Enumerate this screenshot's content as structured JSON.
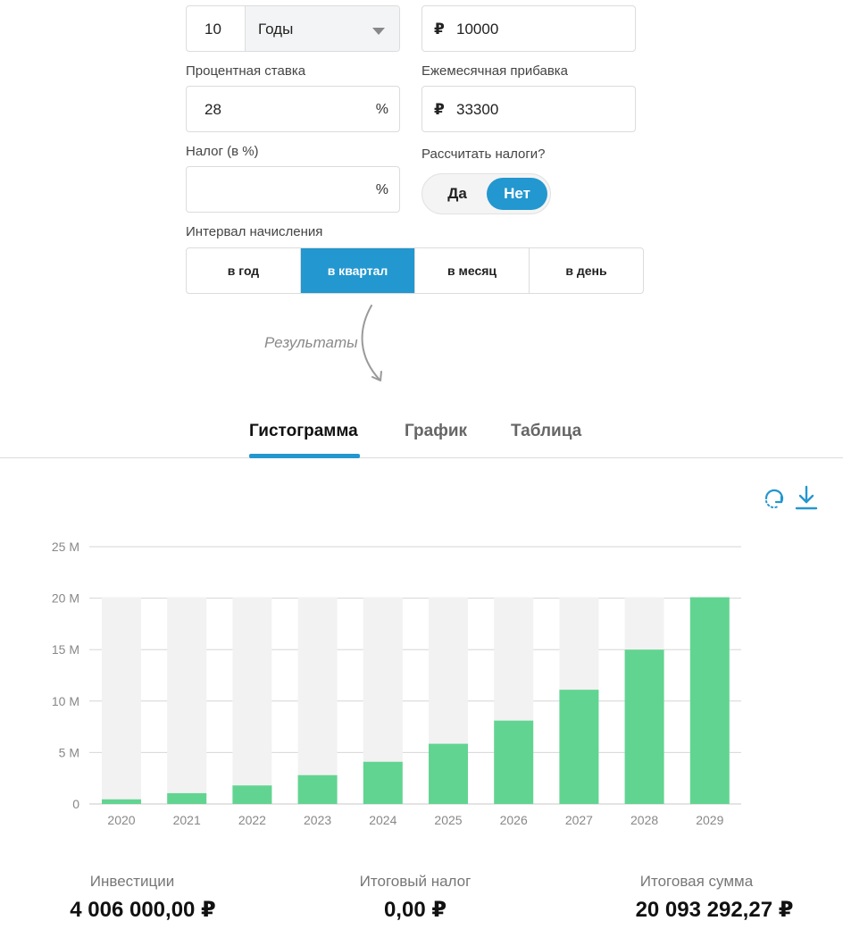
{
  "form": {
    "years_value": "10",
    "years_unit": "Годы",
    "initial_currency": "₽",
    "initial_value": "10000",
    "rate_label": "Процентная ставка",
    "rate_value": "28",
    "rate_suffix": "%",
    "monthly_label": "Ежемесячная прибавка",
    "monthly_currency": "₽",
    "monthly_value": "33300",
    "tax_label": "Налог (в %)",
    "tax_value": "",
    "tax_suffix": "%",
    "calc_tax_label": "Рассчитать налоги?",
    "toggle_yes": "Да",
    "toggle_no": "Нет",
    "interval_label": "Интервал начисления",
    "intervals": [
      "в год",
      "в квартал",
      "в месяц",
      "в день"
    ],
    "selected_interval": "в квартал"
  },
  "results_label": "Результаты",
  "tabs": [
    {
      "label": "Гистограмма",
      "active": true
    },
    {
      "label": "График",
      "active": false
    },
    {
      "label": "Таблица",
      "active": false
    }
  ],
  "icons": [
    "refresh-icon",
    "download-icon"
  ],
  "colors": {
    "accent": "#2397cf",
    "bar": "#62d491",
    "bar_background": "#f2f2f2"
  },
  "chart_data": {
    "type": "bar",
    "categories": [
      "2020",
      "2021",
      "2022",
      "2023",
      "2024",
      "2025",
      "2026",
      "2027",
      "2028",
      "2029"
    ],
    "values": [
      0.45,
      1.05,
      1.8,
      2.8,
      4.1,
      5.85,
      8.1,
      11.1,
      15.0,
      20.09
    ],
    "background_value": 20.09,
    "yticks": [
      "0",
      "5 M",
      "10 M",
      "15 M",
      "20 M",
      "25 M"
    ],
    "ylim": [
      0,
      25
    ],
    "grid": true
  },
  "summary": {
    "investments_label": "Инвестиции",
    "investments_value": "4 006 000,00 ₽",
    "tax_label": "Итоговый налог",
    "tax_value": "0,00 ₽",
    "total_label": "Итоговая сумма",
    "total_value": "20 093 292,27 ₽"
  }
}
